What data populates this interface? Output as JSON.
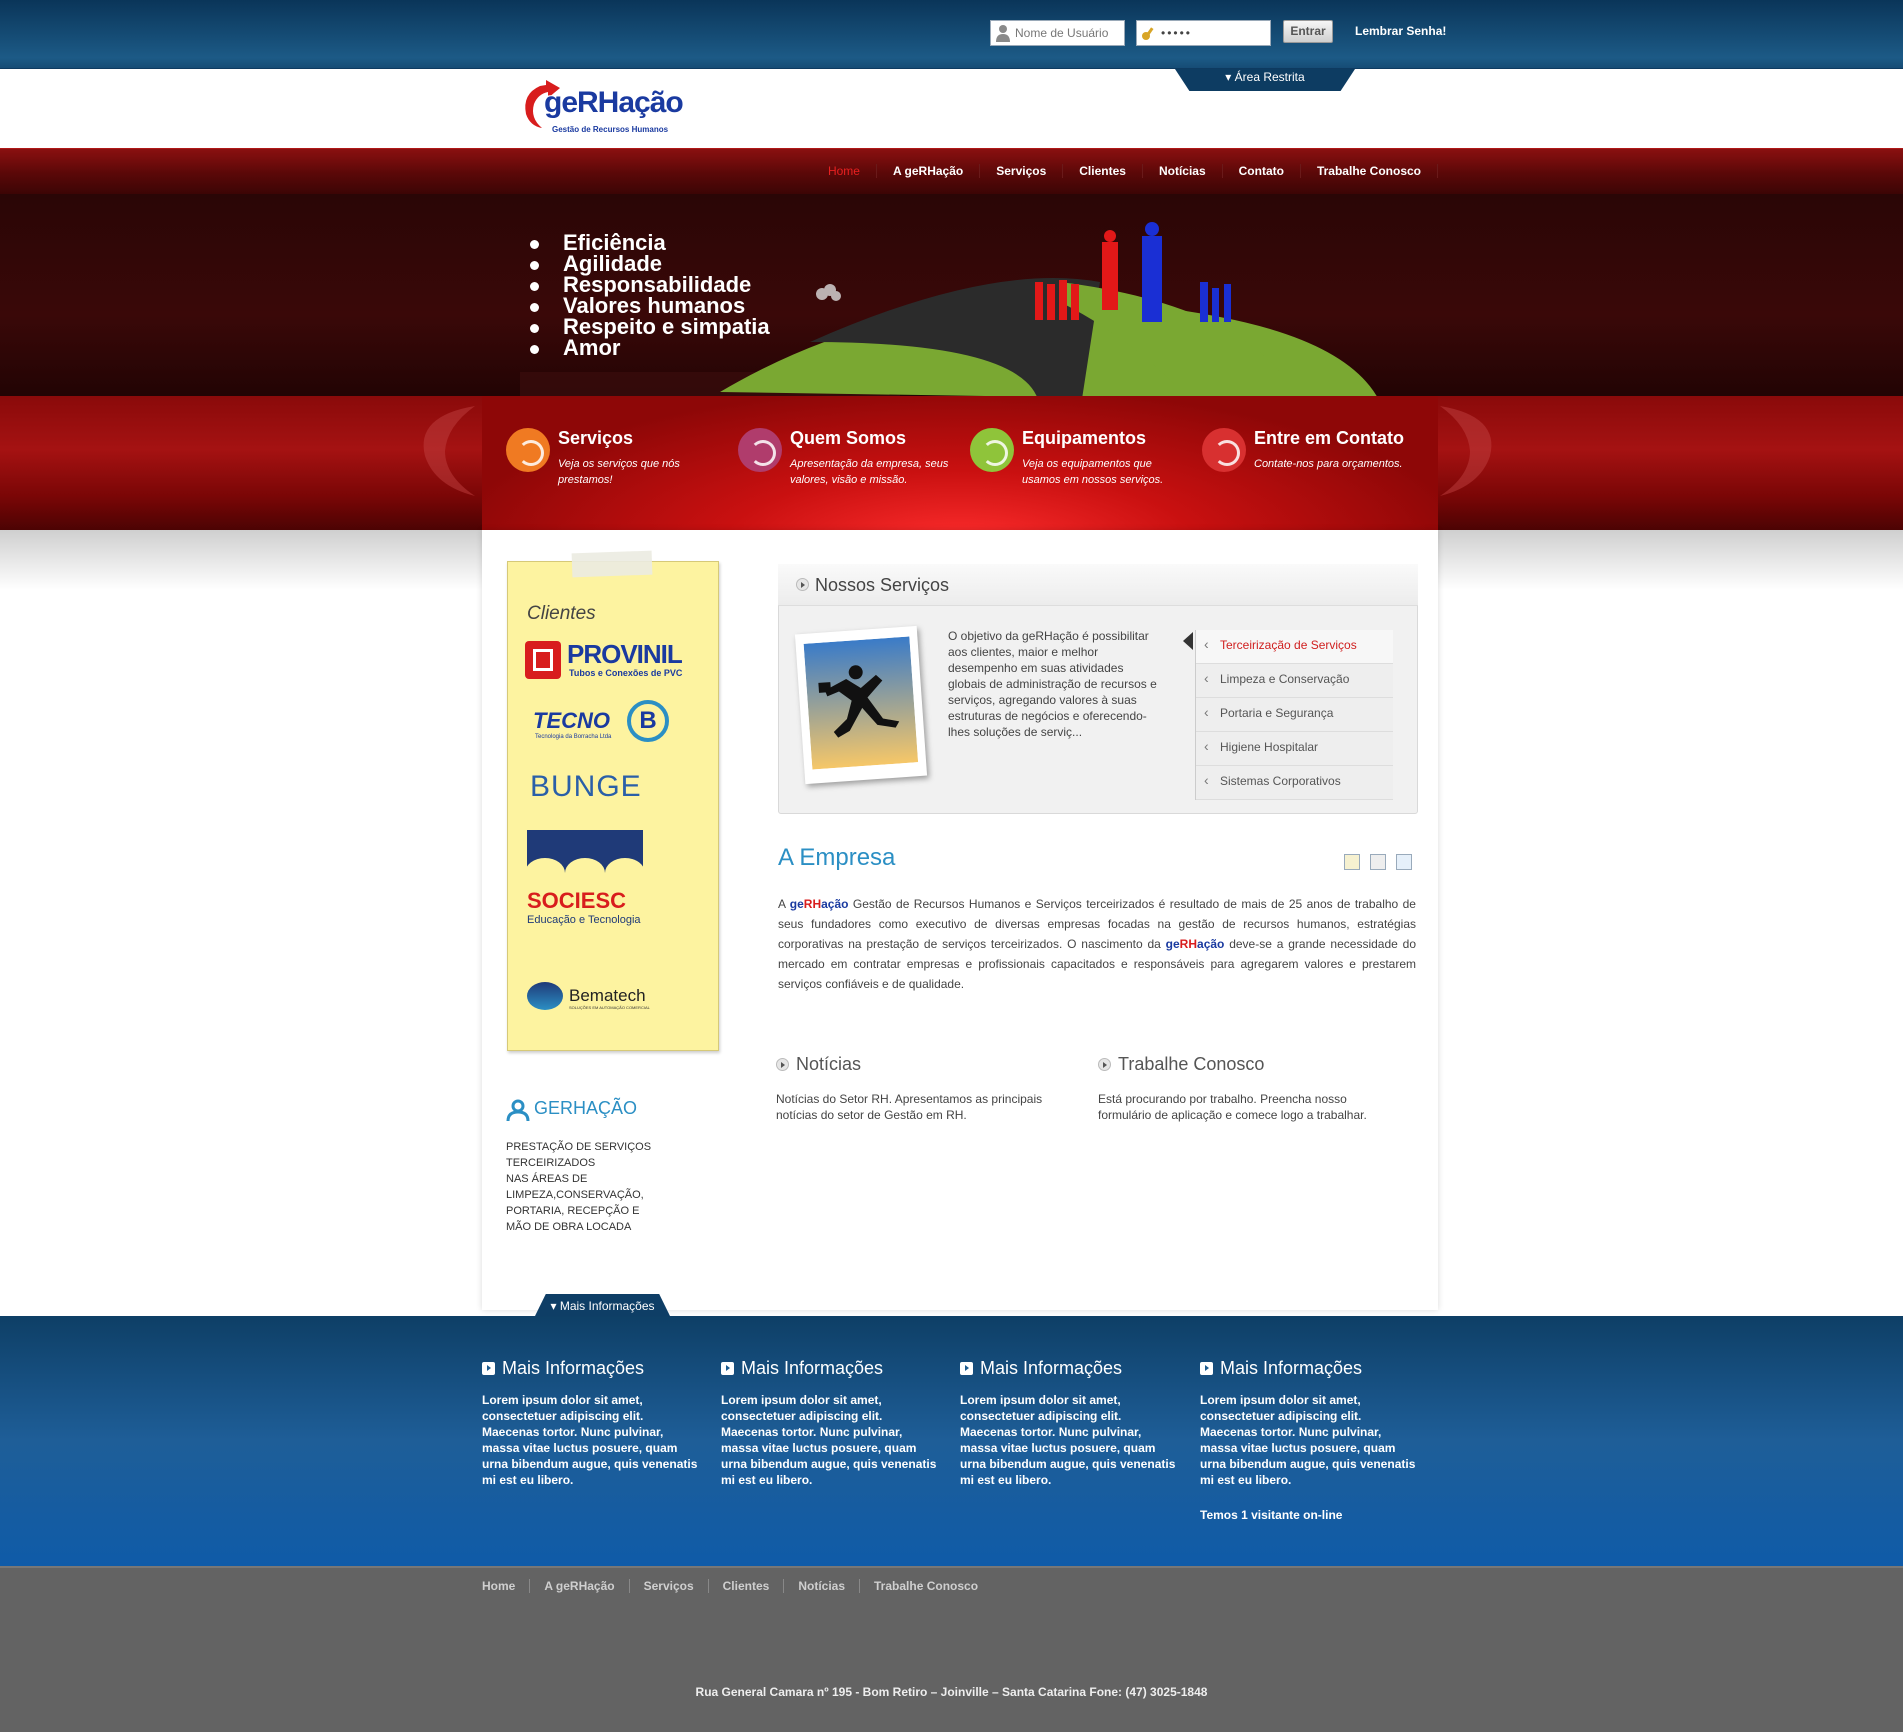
{
  "login": {
    "username_placeholder": "Nome de Usuário",
    "password_value": "•••••",
    "submit_label": "Entrar",
    "forgot_label": "Lembrar Senha!",
    "restricted_tab": "Área Restrita"
  },
  "logo": {
    "name_ge": "ge",
    "name_rh": "RH",
    "name_acao": "ação",
    "tagline": "Gestão de Recursos Humanos"
  },
  "nav": [
    "Home",
    "A geRHação",
    "Serviços",
    "Clientes",
    "Notícias",
    "Contato",
    "Trabalhe Conosco"
  ],
  "banner_values": [
    "Eficiência",
    "Agilidade",
    "Responsabilidade",
    "Valores humanos",
    "Respeito e simpatia",
    "Amor"
  ],
  "features": [
    {
      "title": "Serviços",
      "desc": "Veja os serviços que nós prestamos!",
      "color": "#f07a22"
    },
    {
      "title": "Quem Somos",
      "desc": "Apresentação da empresa, seus valores, visão e missão.",
      "color": "#b03c6c"
    },
    {
      "title": "Equipamentos",
      "desc": "Veja os equipamentos que usamos em nossos serviços.",
      "color": "#8fc43a"
    },
    {
      "title": "Entre em Contato",
      "desc": "Contate-nos para orçamentos.",
      "color": "#d83030"
    }
  ],
  "clientes": {
    "title": "Clientes",
    "provinil": "PROVINIL",
    "provinil_sub": "Tubos e Conexões de PVC",
    "tecnob": "TECNO",
    "tecnob_b": "B",
    "tecnob_sub": "Tecnologia da Borracha Ltda",
    "bunge": "BUNGE",
    "sociesc": "SOCIESC",
    "sociesc_sub": "Educação e Tecnologia",
    "bematech": "Bematech",
    "bematech_sub": "SOLUÇÕES EM AUTOMAÇÃO COMERCIAL"
  },
  "gerhacao": {
    "title": "GERHAÇÃO",
    "text": "PRESTAÇÃO DE SERVIÇOS\nTERCEIRIZADOS\nNAS ÁREAS  DE\nLIMPEZA,CONSERVAÇÃO,\nPORTARIA, RECEPÇÃO  E\nMÃO DE OBRA LOCADA"
  },
  "servicos": {
    "title": "Nossos Serviços",
    "text": "O objetivo da geRHação é possibilitar aos clientes, maior e melhor desempenho em suas atividades globais de administração de recursos e serviços, agregando valores à suas estruturas de negócios e oferecendo-lhes soluções de serviç...",
    "items": [
      "Terceirização de Serviços",
      "Limpeza e Conservação",
      "Portaria e Segurança",
      "Higiene Hospitalar",
      "Sistemas Corporativos"
    ]
  },
  "empresa": {
    "title": "A Empresa",
    "p1": "A ",
    "p2": " Gestão de Recursos Humanos e Serviços terceirizados é resultado de mais de 25 anos de trabalho de seus fundadores como executivo de diversas empresas focadas na gestão de recursos humanos, estratégias corporativas na prestação de serviços terceirizados. O nascimento da ",
    "p3": "  deve-se a grande necessidade do mercado em contratar empresas e profissionais capacitados e responsáveis para agregarem valores e prestarem serviços confiáveis e de qualidade."
  },
  "noticias": {
    "title": "Notícias",
    "text": "Notícias do Setor RH. Apresentamos as principais notícias do setor de Gestão em RH."
  },
  "trabalhe": {
    "title": "Trabalhe Conosco",
    "text": "Está procurando por trabalho. Preencha nosso formulário de aplicação e comece logo a trabalhar."
  },
  "footer": {
    "tab": "Mais Informações",
    "columns": [
      {
        "title": "Mais Informações",
        "text": "Lorem ipsum dolor sit amet, consectetuer adipiscing elit. Maecenas tortor. Nunc pulvinar, massa vitae luctus posuere, quam urna bibendum augue, quis venenatis mi est eu libero."
      },
      {
        "title": "Mais Informações",
        "text": "Lorem ipsum dolor sit amet, consectetuer adipiscing elit. Maecenas tortor. Nunc pulvinar, massa vitae luctus posuere, quam urna bibendum augue, quis venenatis mi est eu libero."
      },
      {
        "title": "Mais Informações",
        "text": "Lorem ipsum dolor sit amet, consectetuer adipiscing elit. Maecenas tortor. Nunc pulvinar, massa vitae luctus posuere, quam urna bibendum augue, quis venenatis mi est eu libero."
      },
      {
        "title": "Mais Informações",
        "text": "Lorem ipsum dolor sit amet, consectetuer adipiscing elit. Maecenas tortor. Nunc pulvinar, massa vitae luctus posuere, quam urna bibendum augue, quis venenatis mi est eu libero."
      }
    ],
    "visitors": "Temos 1 visitante on-line",
    "nav": [
      "Home",
      "A geRHação",
      "Serviços",
      "Clientes",
      "Notícias",
      "Trabalhe Conosco"
    ],
    "address": "Rua General Camara nº 195 - Bom Retiro – Joinville – Santa Catarina Fone: (47) 3025-1848"
  },
  "colors": {
    "brand_red": "#d81d1d",
    "brand_blue": "#1a3aa0",
    "accent_blue": "#2b8fc4",
    "nav_active": "#e82020"
  }
}
